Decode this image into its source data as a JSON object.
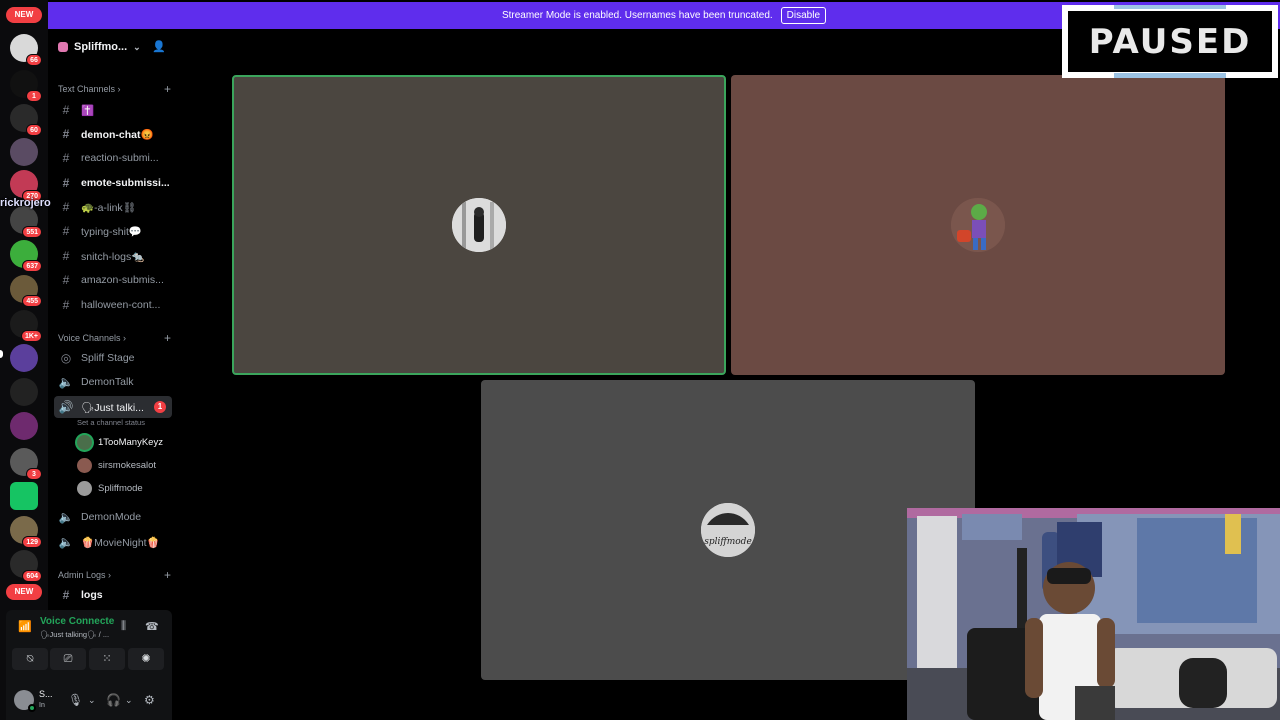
{
  "banner": {
    "message": "Streamer Mode is enabled. Usernames have been truncated.",
    "disable_label": "Disable"
  },
  "paused_overlay": {
    "label": "PAUSED"
  },
  "rail": {
    "new_top": "NEW",
    "new_bottom": "NEW",
    "badges": [
      "66",
      "1",
      "60",
      "270",
      "551",
      "637",
      "455",
      "1K+",
      "3",
      "129",
      "604"
    ]
  },
  "server": {
    "name": "Spliffmo..."
  },
  "floating_username": "rickrojero",
  "categories": {
    "text": "Text Channels",
    "voice": "Voice Channels",
    "admin": "Admin Logs"
  },
  "text_channels": [
    {
      "name": "✝️"
    },
    {
      "name": "demon-chat😡"
    },
    {
      "name": "reaction-submi..."
    },
    {
      "name": "emote-submissi..."
    },
    {
      "name": "🐢-a-link⛓"
    },
    {
      "name": "typing-shit💬"
    },
    {
      "name": "snitch-logs🐀"
    },
    {
      "name": "amazon-submis..."
    },
    {
      "name": "halloween-cont..."
    }
  ],
  "voice_channels": [
    {
      "name": "Spliff Stage"
    },
    {
      "name": "DemonTalk"
    },
    {
      "name": "🗣Just talki...",
      "mention": "1",
      "status": "Set a channel status"
    },
    {
      "name": "DemonMode"
    },
    {
      "name": "🍿MovieNight🍿"
    }
  ],
  "voice_users": [
    "1TooManyKeyz",
    "sirsmokesalot",
    "Spliffmode"
  ],
  "admin_channels": [
    {
      "name": "logs"
    }
  ],
  "voice_panel": {
    "title": "Voice Connecte",
    "subtitle": "🗣Just talking🗣 / ..."
  },
  "user_panel": {
    "name": "S...",
    "status": "In"
  },
  "tiles": {
    "t3_avatar_text": "spliffmode"
  },
  "colors": {
    "banner": "#5f2ded",
    "speaking": "#3ba55c",
    "mention": "#f23f43"
  }
}
